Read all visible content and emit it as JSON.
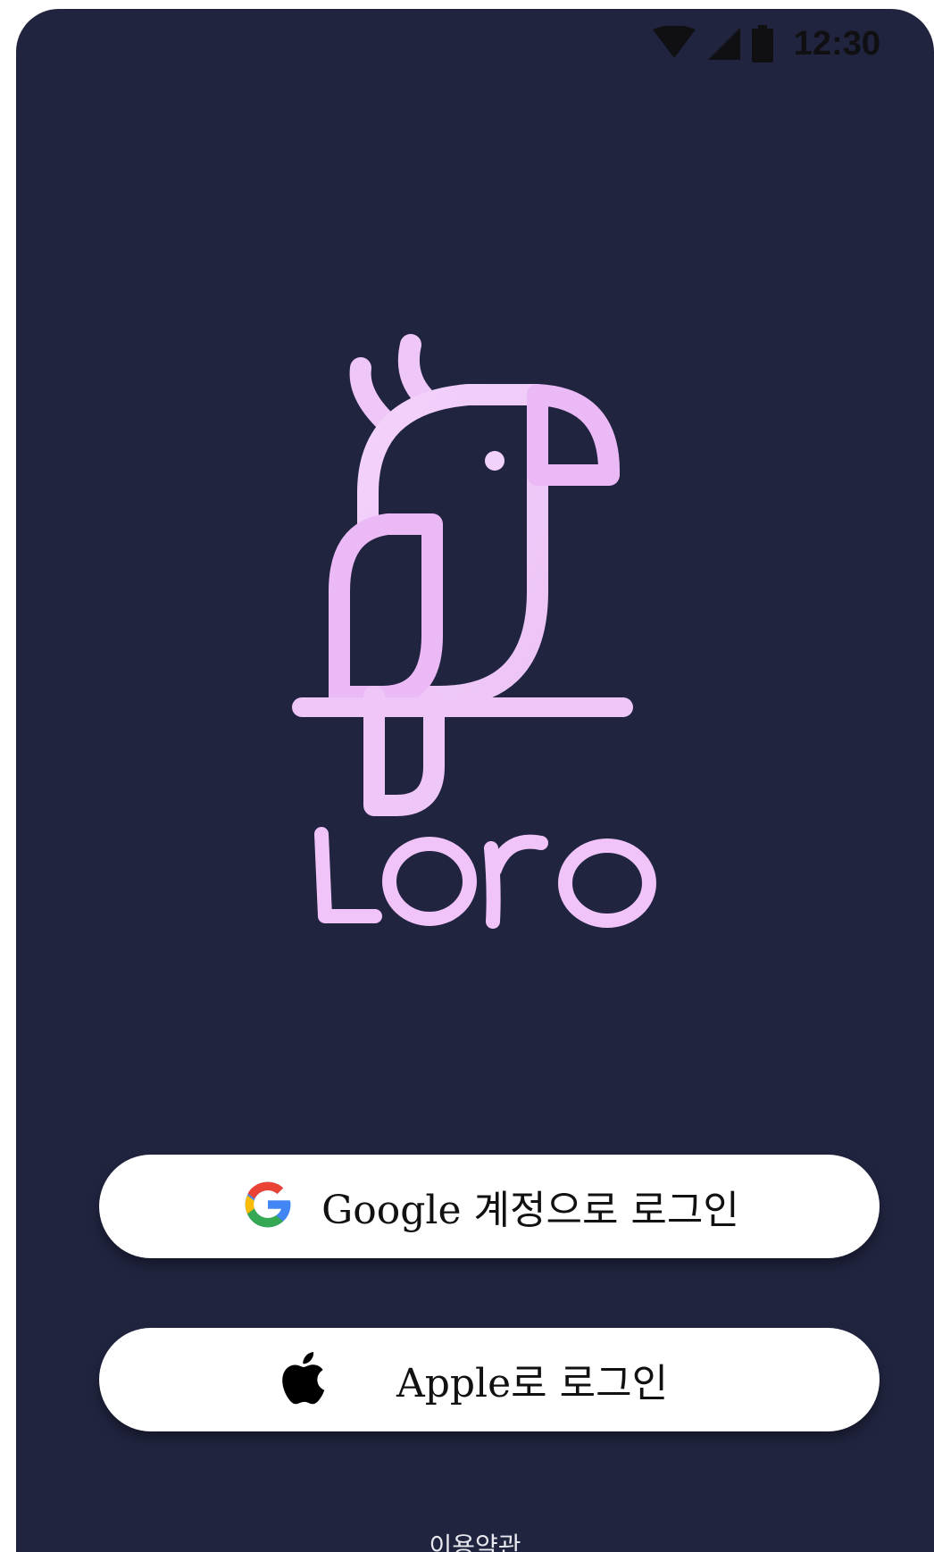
{
  "status_bar": {
    "time": "12:30",
    "icons": [
      "wifi-icon",
      "signal-icon",
      "battery-icon"
    ],
    "icon_color": "#101012"
  },
  "brand": {
    "name": "Loro",
    "logo": "parrot-logo",
    "color": "#efbff8"
  },
  "buttons": {
    "google": {
      "label": "Google 계정으로 로그인",
      "icon": "google-g-icon"
    },
    "apple": {
      "label": "Apple로 로그인",
      "icon": "apple-icon"
    }
  },
  "footer": {
    "terms_text": "이용약관"
  },
  "colors": {
    "background": "#20243f",
    "button_bg": "#ffffff",
    "button_text": "#111111"
  }
}
